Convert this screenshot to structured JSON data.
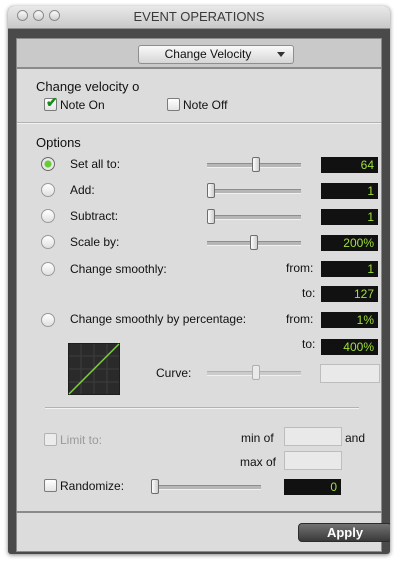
{
  "window": {
    "title": "EVENT OPERATIONS"
  },
  "operation_menu": {
    "selected": "Change Velocity"
  },
  "change_velocity": {
    "heading": "Change velocity o",
    "note_on": {
      "label": "Note On",
      "checked": true
    },
    "note_off": {
      "label": "Note Off",
      "checked": false
    }
  },
  "options": {
    "heading": "Options",
    "set_all_to": {
      "label": "Set all to:",
      "selected": true,
      "value": "64",
      "slider_fraction": 0.5
    },
    "add": {
      "label": "Add:",
      "value": "1",
      "slider_fraction": 0.0
    },
    "subtract": {
      "label": "Subtract:",
      "value": "1",
      "slider_fraction": 0.0
    },
    "scale_by": {
      "label": "Scale by:",
      "value": "200%",
      "slider_fraction": 0.5
    },
    "change_smoothly": {
      "label": "Change smoothly:",
      "from_label": "from:",
      "from_value": "1",
      "to_label": "to:",
      "to_value": "127"
    },
    "change_smoothly_pct": {
      "label": "Change smoothly by percentage:",
      "from_label": "from:",
      "from_value": "1%",
      "to_label": "to:",
      "to_value": "400%"
    },
    "curve": {
      "label": "Curve:",
      "slider_fraction": 0.5,
      "value": ""
    }
  },
  "limit": {
    "label": "Limit to:",
    "min_label": "min of",
    "and_label": "and",
    "max_label": "max of",
    "min_value": "",
    "max_value": ""
  },
  "randomize": {
    "label": "Randomize:",
    "value": "0",
    "slider_fraction": 0.0
  },
  "apply_button": {
    "label": "Apply"
  },
  "colors": {
    "accent_green": "#9fe03a",
    "value_bg": "#111111",
    "panel": "#dcdcdc",
    "frame": "#4a4a4a"
  }
}
